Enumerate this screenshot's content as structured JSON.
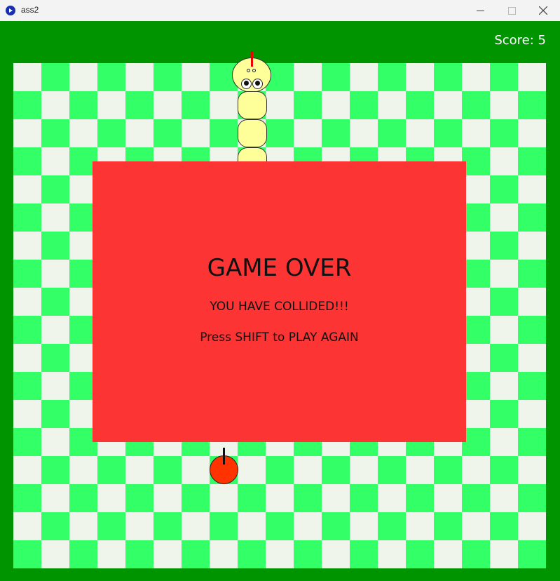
{
  "window": {
    "title": "ass2"
  },
  "hud": {
    "score_text": "Score: 5"
  },
  "game_over": {
    "title": "GAME OVER",
    "message": "YOU HAVE COLLIDED!!!",
    "hint": "Press SHIFT to PLAY AGAIN"
  },
  "colors": {
    "border": "#009400",
    "tile_light": "#f0f5ec",
    "tile_dark": "#33ff66",
    "overlay": "#fd3434",
    "snake": "#ffff99",
    "apple": "#ff3300"
  },
  "icons": [
    "app-icon",
    "minimize-icon",
    "maximize-icon",
    "close-icon"
  ]
}
